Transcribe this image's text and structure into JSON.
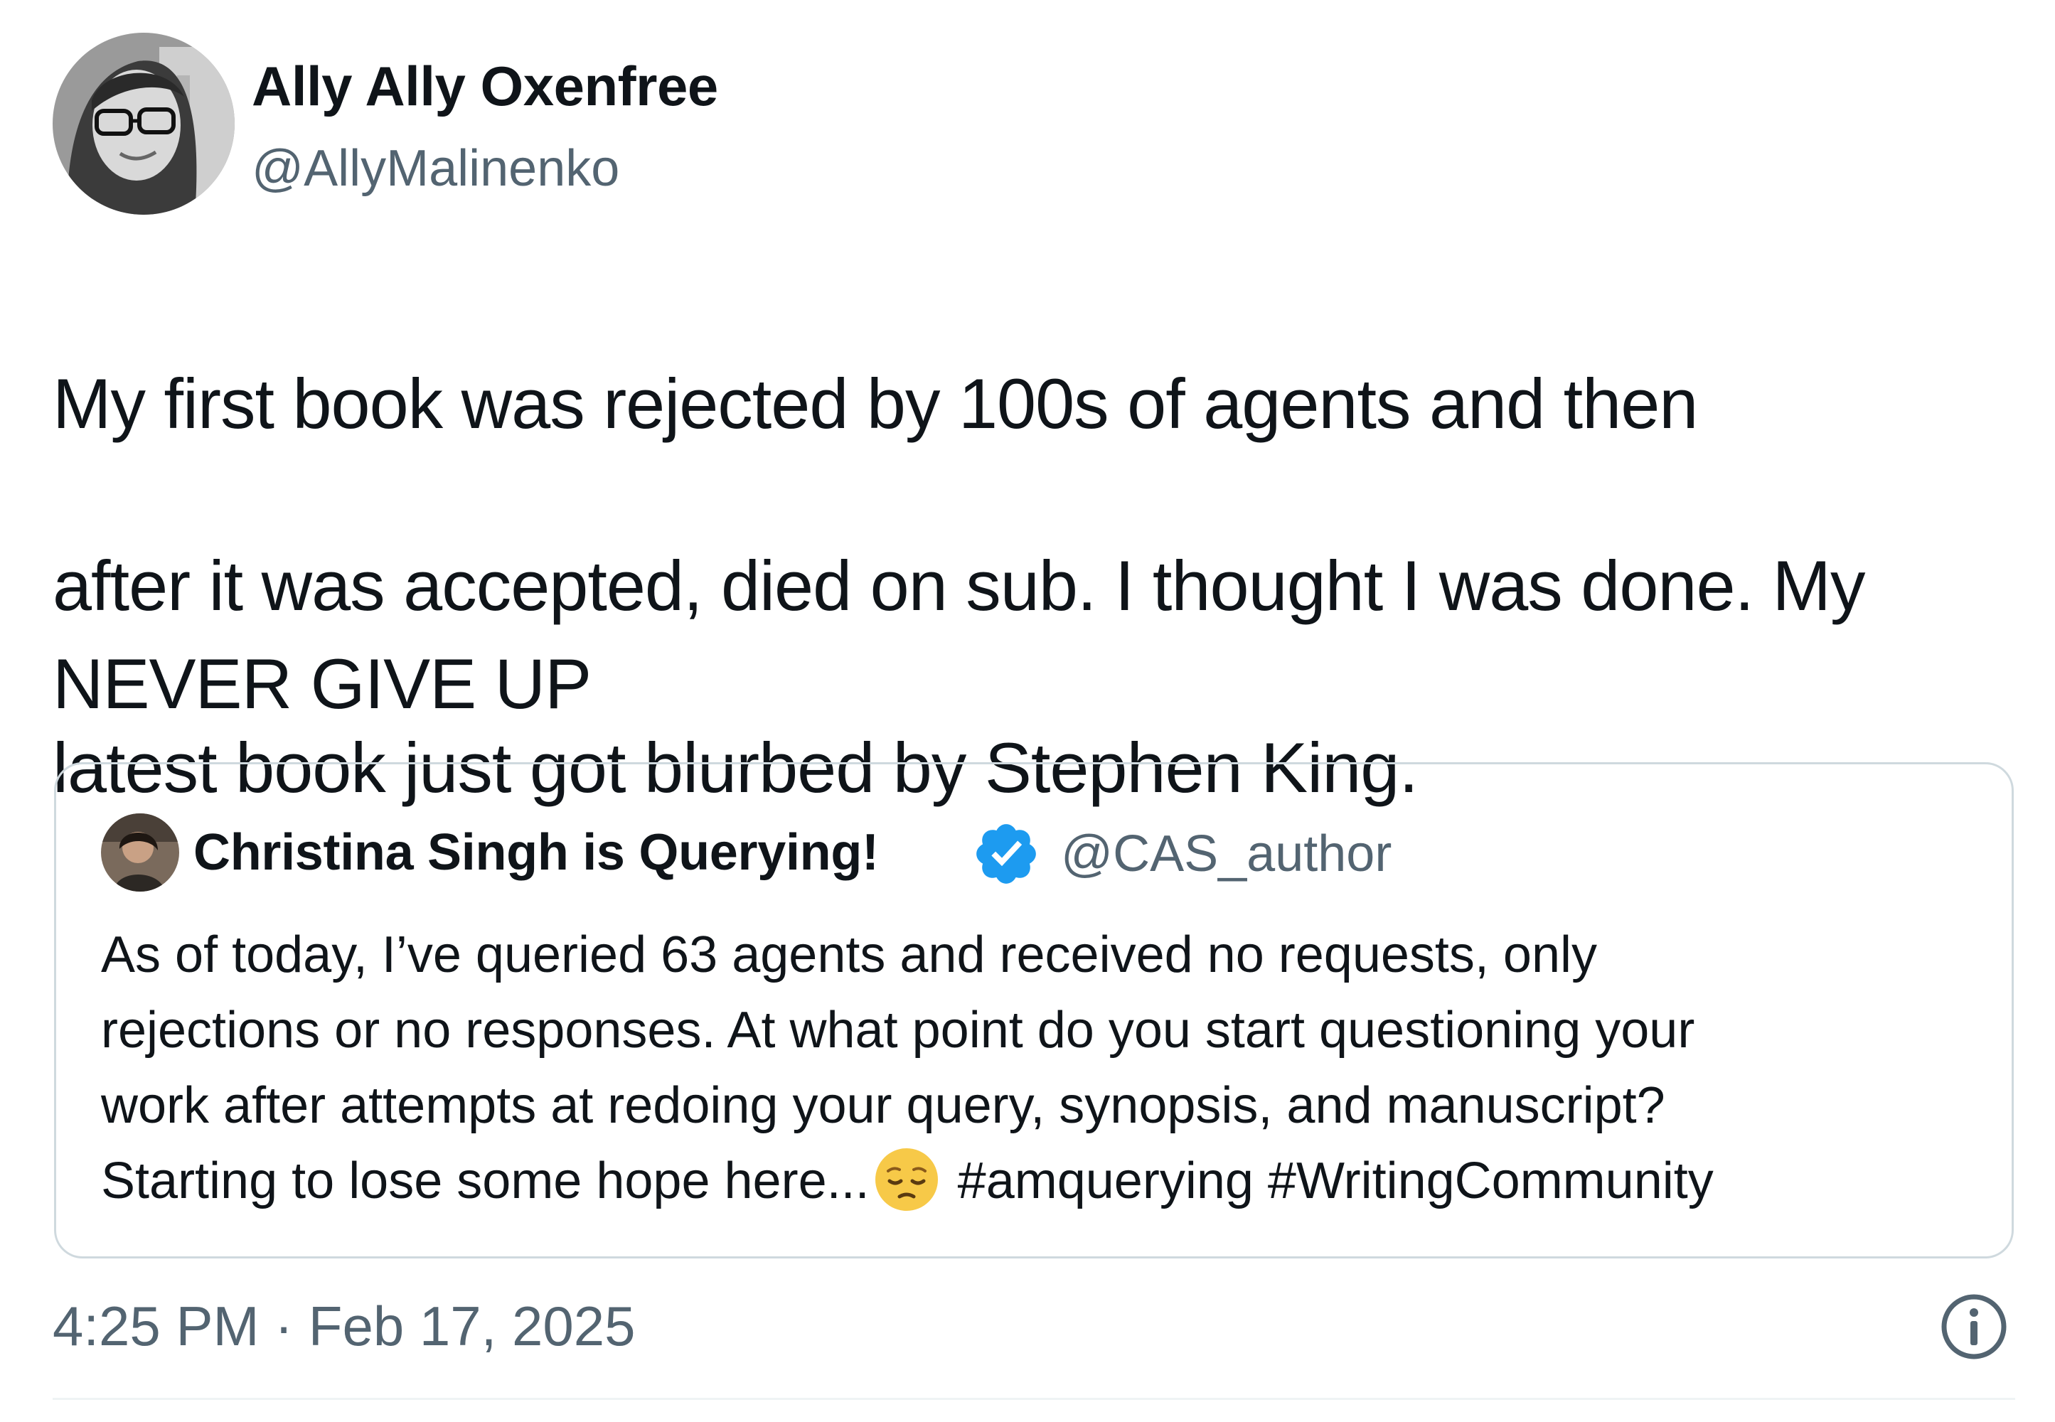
{
  "author": {
    "display_name": "Ally Ally Oxenfree",
    "handle": "@AllyMalinenko",
    "avatar_icon": "user-photo-avatar"
  },
  "tweet": {
    "lines": [
      "My first book was rejected by 100s of agents and then",
      "after it was accepted, died on sub. I thought I was done. My",
      "latest book just got blurbed by Stephen King."
    ],
    "emphasis": "NEVER GIVE UP"
  },
  "quote": {
    "display_name": "Christina Singh is Querying!",
    "verified_icon": "verified-badge-icon",
    "verified_color": "#1d9bf0",
    "handle": "@CAS_author",
    "lines": [
      "As of today, I’ve queried 63 agents and received no requests, only",
      "rejections or no responses. At what point do you start questioning your",
      "work after attempts at redoing your query, synopsis, and manuscript?"
    ],
    "last_line_prefix": "Starting to lose some hope here...",
    "emoji_icon": "pensive-face-emoji",
    "hashtags": "#amquerying #WritingCommunity"
  },
  "meta": {
    "timestamp": "4:25 PM · Feb 17, 2025",
    "info_icon": "info-icon"
  },
  "colors": {
    "text": "#0f1419",
    "secondary": "#536471",
    "border": "#cfd9de"
  }
}
